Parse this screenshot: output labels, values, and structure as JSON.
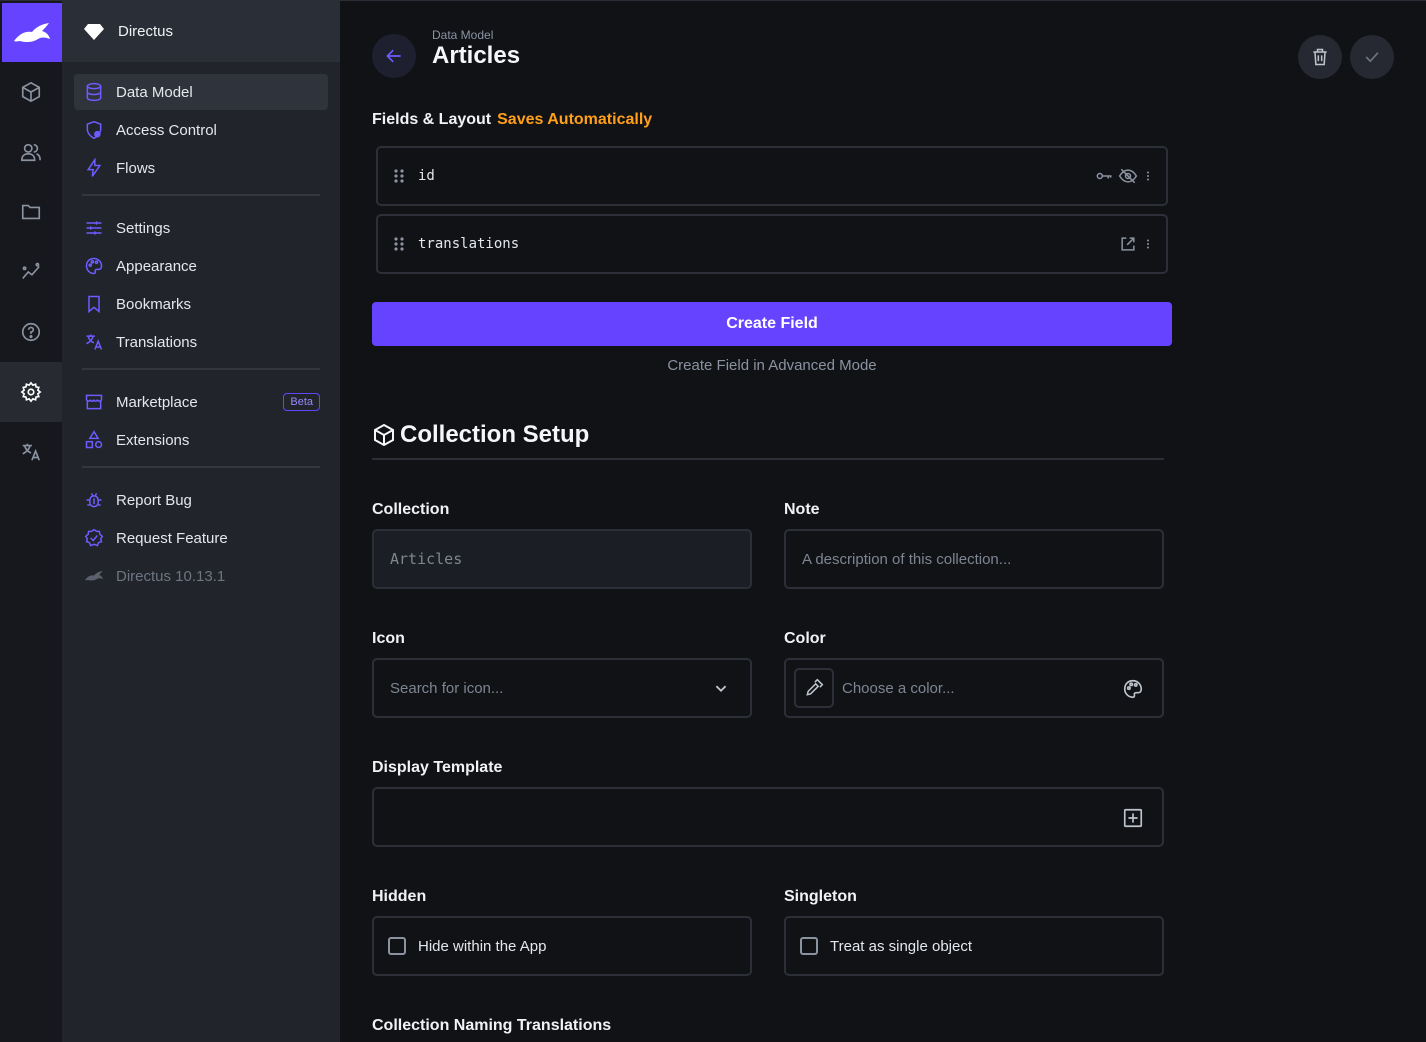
{
  "project": {
    "name": "Directus"
  },
  "colors": {
    "accent": "#6644ff",
    "warning": "#ff9f1a"
  },
  "modules": [
    {
      "icon": "cube-icon",
      "name": "content"
    },
    {
      "icon": "users-icon",
      "name": "user-directory"
    },
    {
      "icon": "folder-icon",
      "name": "files"
    },
    {
      "icon": "insights-icon",
      "name": "insights"
    },
    {
      "icon": "help-icon",
      "name": "help"
    },
    {
      "icon": "gear-icon",
      "name": "settings",
      "active": true
    },
    {
      "icon": "translate-icon",
      "name": "translations"
    }
  ],
  "nav": {
    "data_model": "Data Model",
    "access_control": "Access Control",
    "flows": "Flows",
    "settings": "Settings",
    "appearance": "Appearance",
    "bookmarks": "Bookmarks",
    "translations": "Translations",
    "marketplace": "Marketplace",
    "marketplace_badge": "Beta",
    "extensions": "Extensions",
    "report_bug": "Report Bug",
    "request_feature": "Request Feature",
    "version": "Directus 10.13.1"
  },
  "header": {
    "breadcrumb": "Data Model",
    "title": "Articles"
  },
  "fields_layout": {
    "title": "Fields & Layout",
    "status": "Saves Automatically",
    "fields": [
      {
        "name": "id"
      },
      {
        "name": "translations"
      }
    ],
    "create_field": "Create Field",
    "create_advanced": "Create Field in Advanced Mode"
  },
  "collection_setup": {
    "title": "Collection Setup",
    "collection_label": "Collection",
    "collection_value": "Articles",
    "note_label": "Note",
    "note_placeholder": "A description of this collection...",
    "icon_label": "Icon",
    "icon_placeholder": "Search for icon...",
    "color_label": "Color",
    "color_placeholder": "Choose a color...",
    "display_template_label": "Display Template",
    "hidden_label": "Hidden",
    "hidden_checkbox": "Hide within the App",
    "singleton_label": "Singleton",
    "singleton_checkbox": "Treat as single object",
    "naming_translations_label": "Collection Naming Translations"
  }
}
